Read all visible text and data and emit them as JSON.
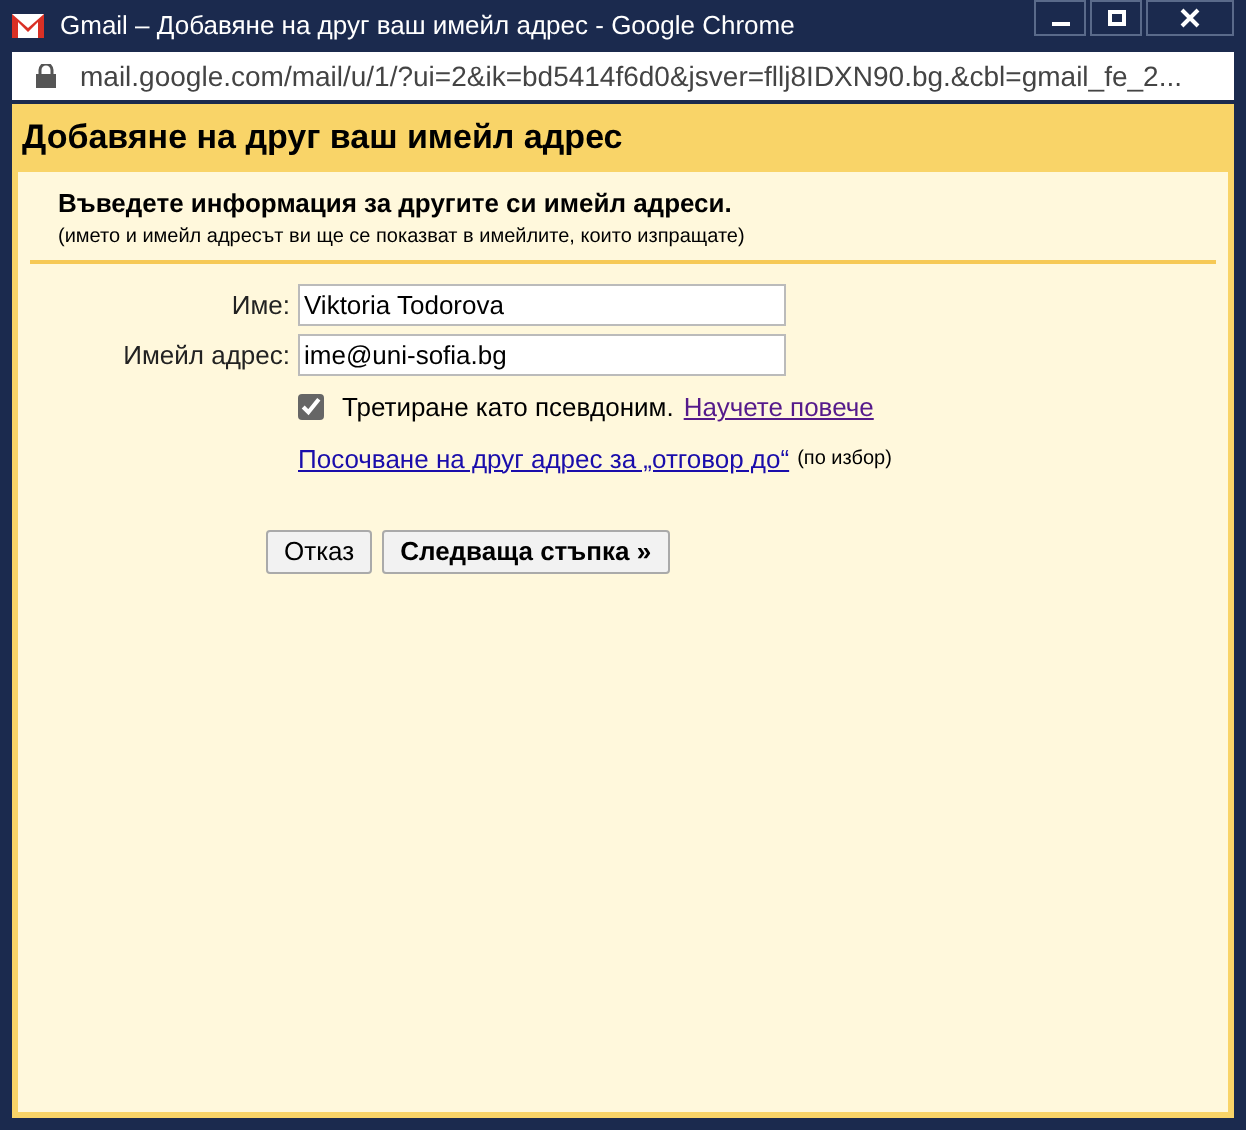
{
  "window": {
    "title": "Gmail – Добавяне на друг ваш имейл адрес - Google Chrome"
  },
  "address_bar": {
    "url": "mail.google.com/mail/u/1/?ui=2&ik=bd5414f6d0&jsver=fllj8IDXN90.bg.&cbl=gmail_fe_2..."
  },
  "dialog": {
    "title": "Добавяне на друг ваш имейл адрес",
    "heading": "Въведете информация за другите си имейл адреси.",
    "subheading": "(името и имейл адресът ви ще се показват в имейлите, които изпращате)",
    "fields": [
      {
        "label": "Име:",
        "value": "Viktoria Todorova"
      },
      {
        "label": "Имейл адрес:",
        "value": "ime@uni-sofia.bg"
      }
    ],
    "alias": {
      "label": "Третиране като псевдоним.",
      "checked": true,
      "link": "Научете повече"
    },
    "reply_to": {
      "link": "Посочване на друг адрес за „отговор до“",
      "note": "(по избор)"
    },
    "buttons": [
      {
        "label": "Отказ",
        "primary": false
      },
      {
        "label": "Следваща стъпка »",
        "primary": true
      }
    ]
  }
}
